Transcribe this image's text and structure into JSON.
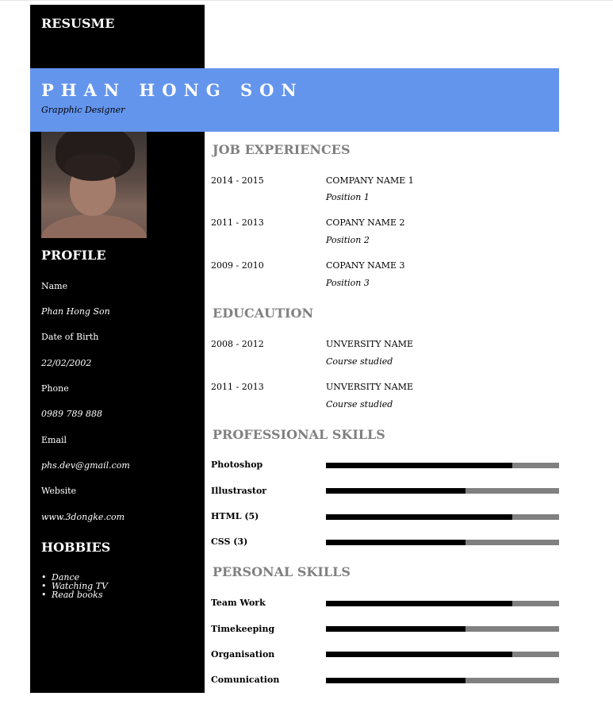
{
  "brand": "RESUSME",
  "header": {
    "name": "PHAN HONG SON",
    "role": "Grapphic Designer"
  },
  "profile": {
    "heading": "PROFILE",
    "fields": [
      {
        "label": "Name",
        "value": "Phan Hong Son"
      },
      {
        "label": "Date of Birth",
        "value": "22/02/2002"
      },
      {
        "label": "Phone",
        "value": "0989 789 888"
      },
      {
        "label": "Email",
        "value": "phs.dev@gmail.com"
      },
      {
        "label": "Website",
        "value": "www.3dongke.com"
      }
    ]
  },
  "hobbies": {
    "heading": "HOBBIES",
    "items": [
      "Dance",
      "Watching TV",
      "Read books"
    ]
  },
  "jobs": {
    "heading": "JOB EXPERIENCES",
    "items": [
      {
        "years": "2014 - 2015",
        "company": "COMPANY NAME 1",
        "position": "Position 1"
      },
      {
        "years": "2011 - 2013",
        "company": "COPANY NAME 2",
        "position": "Position 2"
      },
      {
        "years": "2009 - 2010",
        "company": "COPANY NAME 3",
        "position": "Position 3"
      }
    ]
  },
  "education": {
    "heading": "EDUCAUTION",
    "items": [
      {
        "years": "2008 - 2012",
        "school": "UNVERSITY NAME",
        "course": "Course studied"
      },
      {
        "years": "2011 - 2013",
        "school": "UNVERSITY NAME",
        "course": "Course studied"
      }
    ]
  },
  "professional_skills": {
    "heading": "PROFESSIONAL SKILLS",
    "items": [
      {
        "name": "Photoshop",
        "level": 0.8
      },
      {
        "name": "Illustrastor",
        "level": 0.6
      },
      {
        "name": "HTML (5)",
        "level": 0.8
      },
      {
        "name": "CSS (3)",
        "level": 0.6
      }
    ]
  },
  "personal_skills": {
    "heading": "PERSONAL SKILLS",
    "items": [
      {
        "name": "Team Work",
        "level": 0.8
      },
      {
        "name": "Timekeeping",
        "level": 0.6
      },
      {
        "name": "Organisation",
        "level": 0.8
      },
      {
        "name": "Comunication",
        "level": 0.6
      }
    ]
  }
}
